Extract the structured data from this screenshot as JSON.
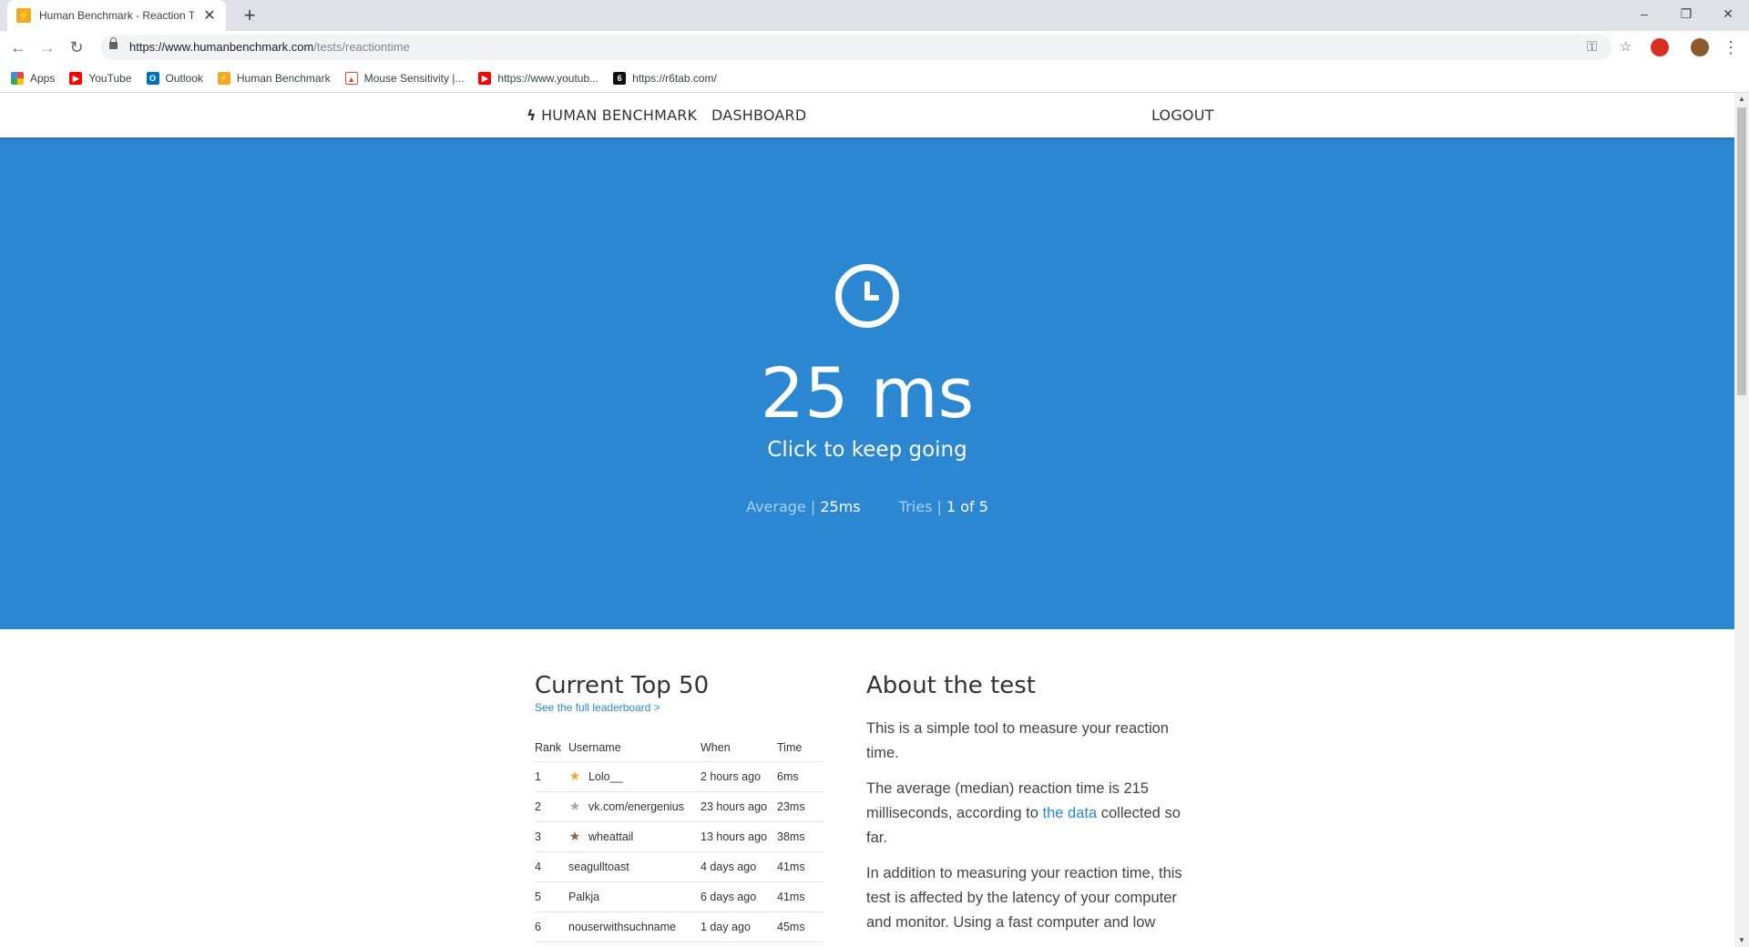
{
  "browser": {
    "tab_title": "Human Benchmark - Reaction Ti",
    "tab_favicon": "⚡",
    "url_host": "https://www.humanbenchmark.com",
    "url_path": "/tests/reactiontime",
    "bookmarks": [
      {
        "label": "Apps",
        "icon": "apps-grid-icon",
        "color": "#e8453c"
      },
      {
        "label": "YouTube",
        "icon": "youtube-icon",
        "color": "#ff0000"
      },
      {
        "label": "Outlook",
        "icon": "outlook-icon",
        "color": "#0072c6"
      },
      {
        "label": "Human Benchmark",
        "icon": "human-benchmark-icon",
        "color": "#f5a623"
      },
      {
        "label": "Mouse Sensitivity |...",
        "icon": "mouse-sensitivity-icon",
        "color": "#e8453c"
      },
      {
        "label": "https://www.youtub...",
        "icon": "youtube-icon",
        "color": "#ff0000"
      },
      {
        "label": "https://r6tab.com/",
        "icon": "r6tab-icon",
        "color": "#111111"
      }
    ]
  },
  "nav": {
    "brand": "HUMAN BENCHMARK",
    "dashboard": "DASHBOARD",
    "logout": "LOGOUT"
  },
  "hero": {
    "background": "#2b87d1",
    "result": "25 ms",
    "prompt": "Click to keep going",
    "average_label": "Average | ",
    "average_value": "25ms",
    "tries_label": "Tries | ",
    "tries_value": "1 of 5"
  },
  "leaderboard": {
    "title": "Current Top 50",
    "link": "See the full leaderboard >",
    "headers": [
      "Rank",
      "Username",
      "When",
      "Time"
    ],
    "rows": [
      {
        "rank": "1",
        "username": "Lolo__",
        "when": "2 hours ago",
        "time": "6ms",
        "star": "gold"
      },
      {
        "rank": "2",
        "username": "vk.com/energenius",
        "when": "23 hours ago",
        "time": "23ms",
        "star": "silver"
      },
      {
        "rank": "3",
        "username": "wheattail",
        "when": "13 hours ago",
        "time": "38ms",
        "star": "bronze"
      },
      {
        "rank": "4",
        "username": "seagulltoast",
        "when": "4 days ago",
        "time": "41ms",
        "star": ""
      },
      {
        "rank": "5",
        "username": "Palkja",
        "when": "6 days ago",
        "time": "41ms",
        "star": ""
      },
      {
        "rank": "6",
        "username": "nouserwithsuchname",
        "when": "1 day ago",
        "time": "45ms",
        "star": ""
      }
    ]
  },
  "about": {
    "title": "About the test",
    "p1": "This is a simple tool to measure your reaction time.",
    "p2_before": "The average (median) reaction time is 215 milliseconds, according to ",
    "p2_link": "the data",
    "p2_after": " collected so far.",
    "p3": "In addition to measuring your reaction time, this test is affected by the latency of your computer and monitor. Using a fast computer and low"
  },
  "colors": {
    "star_gold": "#e8a93b",
    "star_silver": "#a7a7a7",
    "star_bronze": "#8c6239"
  }
}
